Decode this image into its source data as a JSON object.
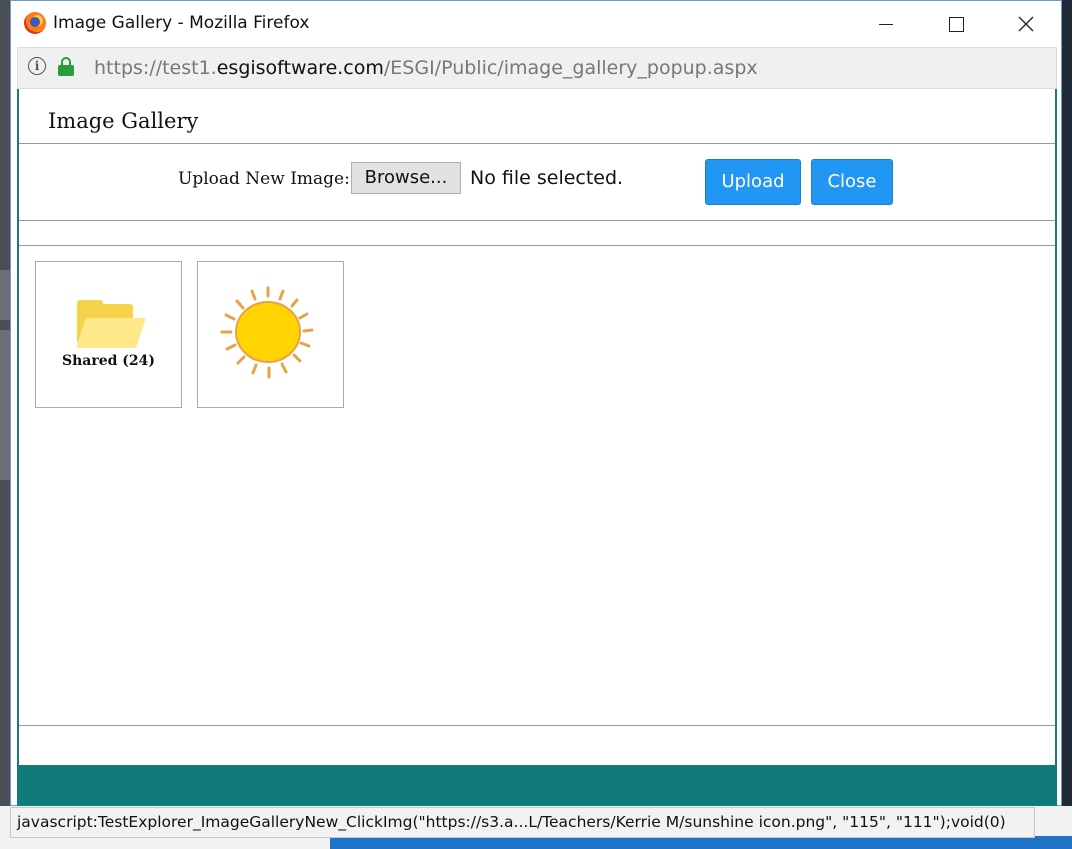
{
  "window": {
    "title": "Image Gallery - Mozilla Firefox"
  },
  "urlbar": {
    "url_prefix": "https://test1.",
    "url_host": "esgisoftware.com",
    "url_path": "/ESGI/Public/image_gallery_popup.aspx"
  },
  "popup": {
    "title": "Image Gallery",
    "upload_label": "Upload New Image:",
    "browse_label": "Browse...",
    "file_status": "No file selected.",
    "upload_button": "Upload",
    "close_button": "Close"
  },
  "gallery": {
    "items": [
      {
        "type": "folder",
        "label": "Shared (24)",
        "icon": "folder-icon"
      },
      {
        "type": "image",
        "label": "",
        "icon": "sun-icon"
      }
    ]
  },
  "statusbar": {
    "text": "javascript:TestExplorer_ImageGalleryNew_ClickImg(\"https://s3.a...L/Teachers/Kerrie M/sunshine icon.png\", \"115\", \"111\");void(0)"
  },
  "colors": {
    "accent_button": "#2196f3",
    "teal_frame": "#117a7a",
    "lock_green": "#2a9d3a"
  }
}
